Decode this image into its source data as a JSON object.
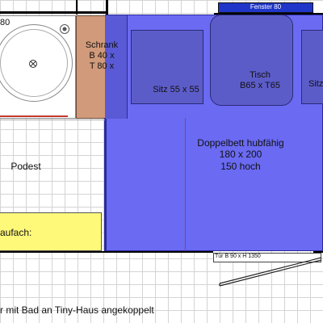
{
  "floorplan": {
    "window_label": "Fenster 80",
    "cabinet_label": "Schrank\nB 40 x\nT 80 x",
    "sink_partial_label": "80",
    "seat_left_label": "Sitz 55 x 55",
    "table_label": "Tisch\nB65 x T65",
    "seat_right_partial_label": "Sitz",
    "bed_label": "Doppelbett hubfähig\n180 x 200\n150 hoch",
    "podest_label": "Podest",
    "yellow_box_label": "aufach:",
    "door_label": "Tür  B 90 x H 1350",
    "bottom_caption": "r mit Bad an Tiny-Haus angekoppelt"
  },
  "colors": {
    "bed_fill": "#6a6af2",
    "furniture_fill": "#5c5cc9",
    "cabinet_fill": "#d19a7a",
    "window_fill": "#1f36c8",
    "yellow_fill": "#fff97a",
    "red_line": "#c0392b"
  }
}
